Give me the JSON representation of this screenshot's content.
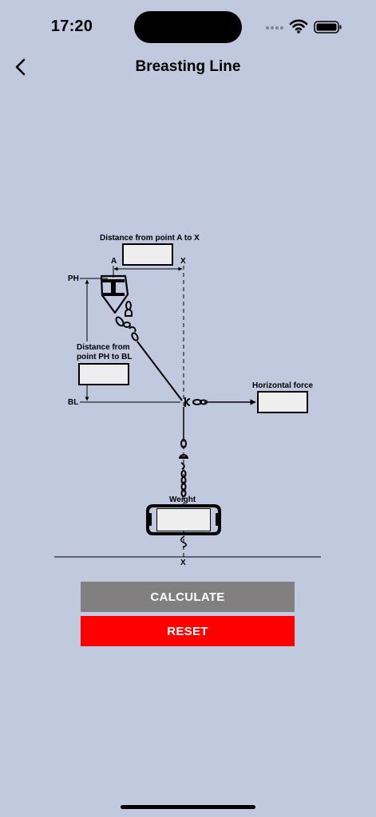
{
  "status_bar": {
    "time": "17:20",
    "icons": [
      "cellular-signal-icon",
      "wifi-icon",
      "battery-icon"
    ]
  },
  "nav": {
    "title": "Breasting Line",
    "back_icon": "chevron-left-icon"
  },
  "diagram": {
    "label_distance_a_x": "Distance from point A to X",
    "label_a": "A",
    "label_x_top": "X",
    "label_ph": "PH",
    "label_distance_ph_bl_1": "Distance from",
    "label_distance_ph_bl_2": "point PH to BL",
    "label_bl": "BL",
    "label_horizontal_force": "Horizontal force",
    "label_weight": "Weight",
    "label_x_bottom": "X",
    "input_distance_a_x": "",
    "input_distance_ph_bl": "",
    "input_horizontal_force": "",
    "input_weight": ""
  },
  "buttons": {
    "calculate": "CALCULATE",
    "reset": "RESET"
  },
  "colors": {
    "background": "#c0c9de",
    "calculate_bg": "#808080",
    "reset_bg": "#ff0000",
    "field_bg": "#eeeeee"
  }
}
